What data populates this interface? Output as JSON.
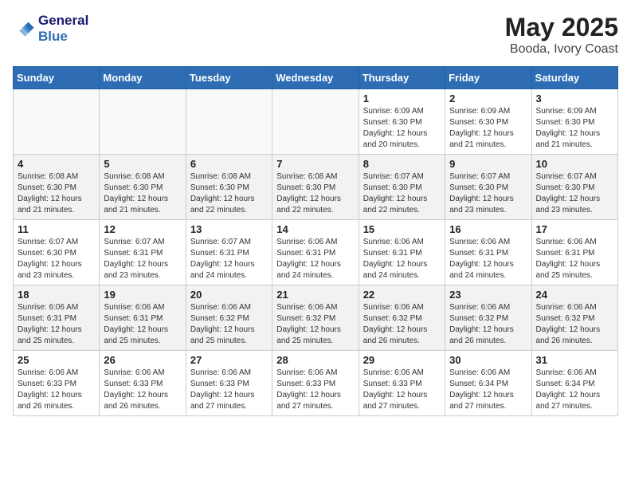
{
  "logo": {
    "line1": "General",
    "line2": "Blue"
  },
  "title": "May 2025",
  "subtitle": "Booda, Ivory Coast",
  "days_of_week": [
    "Sunday",
    "Monday",
    "Tuesday",
    "Wednesday",
    "Thursday",
    "Friday",
    "Saturday"
  ],
  "weeks": [
    [
      {
        "day": "",
        "info": ""
      },
      {
        "day": "",
        "info": ""
      },
      {
        "day": "",
        "info": ""
      },
      {
        "day": "",
        "info": ""
      },
      {
        "day": "1",
        "info": "Sunrise: 6:09 AM\nSunset: 6:30 PM\nDaylight: 12 hours\nand 20 minutes."
      },
      {
        "day": "2",
        "info": "Sunrise: 6:09 AM\nSunset: 6:30 PM\nDaylight: 12 hours\nand 21 minutes."
      },
      {
        "day": "3",
        "info": "Sunrise: 6:09 AM\nSunset: 6:30 PM\nDaylight: 12 hours\nand 21 minutes."
      }
    ],
    [
      {
        "day": "4",
        "info": "Sunrise: 6:08 AM\nSunset: 6:30 PM\nDaylight: 12 hours\nand 21 minutes."
      },
      {
        "day": "5",
        "info": "Sunrise: 6:08 AM\nSunset: 6:30 PM\nDaylight: 12 hours\nand 21 minutes."
      },
      {
        "day": "6",
        "info": "Sunrise: 6:08 AM\nSunset: 6:30 PM\nDaylight: 12 hours\nand 22 minutes."
      },
      {
        "day": "7",
        "info": "Sunrise: 6:08 AM\nSunset: 6:30 PM\nDaylight: 12 hours\nand 22 minutes."
      },
      {
        "day": "8",
        "info": "Sunrise: 6:07 AM\nSunset: 6:30 PM\nDaylight: 12 hours\nand 22 minutes."
      },
      {
        "day": "9",
        "info": "Sunrise: 6:07 AM\nSunset: 6:30 PM\nDaylight: 12 hours\nand 23 minutes."
      },
      {
        "day": "10",
        "info": "Sunrise: 6:07 AM\nSunset: 6:30 PM\nDaylight: 12 hours\nand 23 minutes."
      }
    ],
    [
      {
        "day": "11",
        "info": "Sunrise: 6:07 AM\nSunset: 6:30 PM\nDaylight: 12 hours\nand 23 minutes."
      },
      {
        "day": "12",
        "info": "Sunrise: 6:07 AM\nSunset: 6:31 PM\nDaylight: 12 hours\nand 23 minutes."
      },
      {
        "day": "13",
        "info": "Sunrise: 6:07 AM\nSunset: 6:31 PM\nDaylight: 12 hours\nand 24 minutes."
      },
      {
        "day": "14",
        "info": "Sunrise: 6:06 AM\nSunset: 6:31 PM\nDaylight: 12 hours\nand 24 minutes."
      },
      {
        "day": "15",
        "info": "Sunrise: 6:06 AM\nSunset: 6:31 PM\nDaylight: 12 hours\nand 24 minutes."
      },
      {
        "day": "16",
        "info": "Sunrise: 6:06 AM\nSunset: 6:31 PM\nDaylight: 12 hours\nand 24 minutes."
      },
      {
        "day": "17",
        "info": "Sunrise: 6:06 AM\nSunset: 6:31 PM\nDaylight: 12 hours\nand 25 minutes."
      }
    ],
    [
      {
        "day": "18",
        "info": "Sunrise: 6:06 AM\nSunset: 6:31 PM\nDaylight: 12 hours\nand 25 minutes."
      },
      {
        "day": "19",
        "info": "Sunrise: 6:06 AM\nSunset: 6:31 PM\nDaylight: 12 hours\nand 25 minutes."
      },
      {
        "day": "20",
        "info": "Sunrise: 6:06 AM\nSunset: 6:32 PM\nDaylight: 12 hours\nand 25 minutes."
      },
      {
        "day": "21",
        "info": "Sunrise: 6:06 AM\nSunset: 6:32 PM\nDaylight: 12 hours\nand 25 minutes."
      },
      {
        "day": "22",
        "info": "Sunrise: 6:06 AM\nSunset: 6:32 PM\nDaylight: 12 hours\nand 26 minutes."
      },
      {
        "day": "23",
        "info": "Sunrise: 6:06 AM\nSunset: 6:32 PM\nDaylight: 12 hours\nand 26 minutes."
      },
      {
        "day": "24",
        "info": "Sunrise: 6:06 AM\nSunset: 6:32 PM\nDaylight: 12 hours\nand 26 minutes."
      }
    ],
    [
      {
        "day": "25",
        "info": "Sunrise: 6:06 AM\nSunset: 6:33 PM\nDaylight: 12 hours\nand 26 minutes."
      },
      {
        "day": "26",
        "info": "Sunrise: 6:06 AM\nSunset: 6:33 PM\nDaylight: 12 hours\nand 26 minutes."
      },
      {
        "day": "27",
        "info": "Sunrise: 6:06 AM\nSunset: 6:33 PM\nDaylight: 12 hours\nand 27 minutes."
      },
      {
        "day": "28",
        "info": "Sunrise: 6:06 AM\nSunset: 6:33 PM\nDaylight: 12 hours\nand 27 minutes."
      },
      {
        "day": "29",
        "info": "Sunrise: 6:06 AM\nSunset: 6:33 PM\nDaylight: 12 hours\nand 27 minutes."
      },
      {
        "day": "30",
        "info": "Sunrise: 6:06 AM\nSunset: 6:34 PM\nDaylight: 12 hours\nand 27 minutes."
      },
      {
        "day": "31",
        "info": "Sunrise: 6:06 AM\nSunset: 6:34 PM\nDaylight: 12 hours\nand 27 minutes."
      }
    ]
  ]
}
